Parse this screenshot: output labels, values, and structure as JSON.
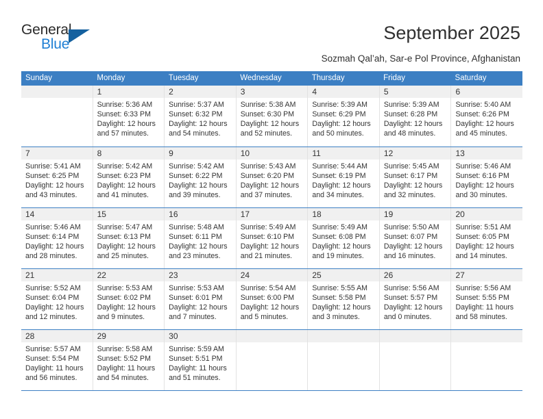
{
  "brand": {
    "name_top": "General",
    "name_bottom": "Blue",
    "triangle_icon": "triangle-icon",
    "accent_color": "#1f7fd4",
    "triangle_color": "#15619f"
  },
  "header": {
    "title": "September 2025",
    "subtitle": "Sozmah Qal’ah, Sar-e Pol Province, Afghanistan"
  },
  "calendar": {
    "header_bg": "#3c7fc3",
    "day_strip_bg": "#f0f0f0",
    "weekdays": [
      "Sunday",
      "Monday",
      "Tuesday",
      "Wednesday",
      "Thursday",
      "Friday",
      "Saturday"
    ],
    "weeks": [
      [
        {
          "day": "",
          "lines": []
        },
        {
          "day": "1",
          "lines": [
            "Sunrise: 5:36 AM",
            "Sunset: 6:33 PM",
            "Daylight: 12 hours",
            "and 57 minutes."
          ]
        },
        {
          "day": "2",
          "lines": [
            "Sunrise: 5:37 AM",
            "Sunset: 6:32 PM",
            "Daylight: 12 hours",
            "and 54 minutes."
          ]
        },
        {
          "day": "3",
          "lines": [
            "Sunrise: 5:38 AM",
            "Sunset: 6:30 PM",
            "Daylight: 12 hours",
            "and 52 minutes."
          ]
        },
        {
          "day": "4",
          "lines": [
            "Sunrise: 5:39 AM",
            "Sunset: 6:29 PM",
            "Daylight: 12 hours",
            "and 50 minutes."
          ]
        },
        {
          "day": "5",
          "lines": [
            "Sunrise: 5:39 AM",
            "Sunset: 6:28 PM",
            "Daylight: 12 hours",
            "and 48 minutes."
          ]
        },
        {
          "day": "6",
          "lines": [
            "Sunrise: 5:40 AM",
            "Sunset: 6:26 PM",
            "Daylight: 12 hours",
            "and 45 minutes."
          ]
        }
      ],
      [
        {
          "day": "7",
          "lines": [
            "Sunrise: 5:41 AM",
            "Sunset: 6:25 PM",
            "Daylight: 12 hours",
            "and 43 minutes."
          ]
        },
        {
          "day": "8",
          "lines": [
            "Sunrise: 5:42 AM",
            "Sunset: 6:23 PM",
            "Daylight: 12 hours",
            "and 41 minutes."
          ]
        },
        {
          "day": "9",
          "lines": [
            "Sunrise: 5:42 AM",
            "Sunset: 6:22 PM",
            "Daylight: 12 hours",
            "and 39 minutes."
          ]
        },
        {
          "day": "10",
          "lines": [
            "Sunrise: 5:43 AM",
            "Sunset: 6:20 PM",
            "Daylight: 12 hours",
            "and 37 minutes."
          ]
        },
        {
          "day": "11",
          "lines": [
            "Sunrise: 5:44 AM",
            "Sunset: 6:19 PM",
            "Daylight: 12 hours",
            "and 34 minutes."
          ]
        },
        {
          "day": "12",
          "lines": [
            "Sunrise: 5:45 AM",
            "Sunset: 6:17 PM",
            "Daylight: 12 hours",
            "and 32 minutes."
          ]
        },
        {
          "day": "13",
          "lines": [
            "Sunrise: 5:46 AM",
            "Sunset: 6:16 PM",
            "Daylight: 12 hours",
            "and 30 minutes."
          ]
        }
      ],
      [
        {
          "day": "14",
          "lines": [
            "Sunrise: 5:46 AM",
            "Sunset: 6:14 PM",
            "Daylight: 12 hours",
            "and 28 minutes."
          ]
        },
        {
          "day": "15",
          "lines": [
            "Sunrise: 5:47 AM",
            "Sunset: 6:13 PM",
            "Daylight: 12 hours",
            "and 25 minutes."
          ]
        },
        {
          "day": "16",
          "lines": [
            "Sunrise: 5:48 AM",
            "Sunset: 6:11 PM",
            "Daylight: 12 hours",
            "and 23 minutes."
          ]
        },
        {
          "day": "17",
          "lines": [
            "Sunrise: 5:49 AM",
            "Sunset: 6:10 PM",
            "Daylight: 12 hours",
            "and 21 minutes."
          ]
        },
        {
          "day": "18",
          "lines": [
            "Sunrise: 5:49 AM",
            "Sunset: 6:08 PM",
            "Daylight: 12 hours",
            "and 19 minutes."
          ]
        },
        {
          "day": "19",
          "lines": [
            "Sunrise: 5:50 AM",
            "Sunset: 6:07 PM",
            "Daylight: 12 hours",
            "and 16 minutes."
          ]
        },
        {
          "day": "20",
          "lines": [
            "Sunrise: 5:51 AM",
            "Sunset: 6:05 PM",
            "Daylight: 12 hours",
            "and 14 minutes."
          ]
        }
      ],
      [
        {
          "day": "21",
          "lines": [
            "Sunrise: 5:52 AM",
            "Sunset: 6:04 PM",
            "Daylight: 12 hours",
            "and 12 minutes."
          ]
        },
        {
          "day": "22",
          "lines": [
            "Sunrise: 5:53 AM",
            "Sunset: 6:02 PM",
            "Daylight: 12 hours",
            "and 9 minutes."
          ]
        },
        {
          "day": "23",
          "lines": [
            "Sunrise: 5:53 AM",
            "Sunset: 6:01 PM",
            "Daylight: 12 hours",
            "and 7 minutes."
          ]
        },
        {
          "day": "24",
          "lines": [
            "Sunrise: 5:54 AM",
            "Sunset: 6:00 PM",
            "Daylight: 12 hours",
            "and 5 minutes."
          ]
        },
        {
          "day": "25",
          "lines": [
            "Sunrise: 5:55 AM",
            "Sunset: 5:58 PM",
            "Daylight: 12 hours",
            "and 3 minutes."
          ]
        },
        {
          "day": "26",
          "lines": [
            "Sunrise: 5:56 AM",
            "Sunset: 5:57 PM",
            "Daylight: 12 hours",
            "and 0 minutes."
          ]
        },
        {
          "day": "27",
          "lines": [
            "Sunrise: 5:56 AM",
            "Sunset: 5:55 PM",
            "Daylight: 11 hours",
            "and 58 minutes."
          ]
        }
      ],
      [
        {
          "day": "28",
          "lines": [
            "Sunrise: 5:57 AM",
            "Sunset: 5:54 PM",
            "Daylight: 11 hours",
            "and 56 minutes."
          ]
        },
        {
          "day": "29",
          "lines": [
            "Sunrise: 5:58 AM",
            "Sunset: 5:52 PM",
            "Daylight: 11 hours",
            "and 54 minutes."
          ]
        },
        {
          "day": "30",
          "lines": [
            "Sunrise: 5:59 AM",
            "Sunset: 5:51 PM",
            "Daylight: 11 hours",
            "and 51 minutes."
          ]
        },
        {
          "day": "",
          "lines": []
        },
        {
          "day": "",
          "lines": []
        },
        {
          "day": "",
          "lines": []
        },
        {
          "day": "",
          "lines": []
        }
      ]
    ]
  }
}
